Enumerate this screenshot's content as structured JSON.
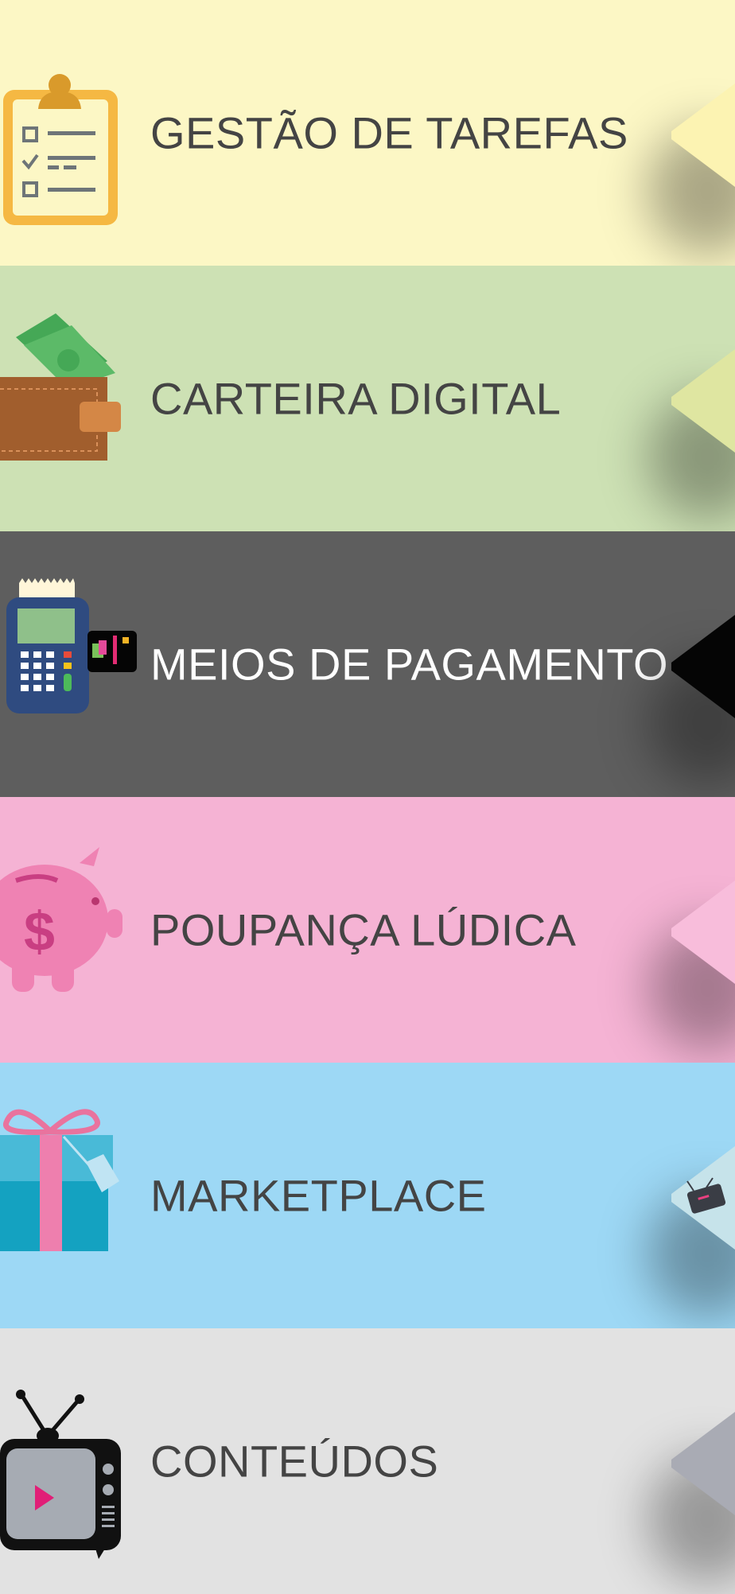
{
  "menu": {
    "items": [
      {
        "key": "tasks",
        "label": "GESTÃO DE TAREFAS",
        "bg": "#FCF7C5",
        "text_color": "#444444",
        "chevron_color": "#FCF3B2",
        "icon": "clipboard-checklist-icon"
      },
      {
        "key": "wallet",
        "label": "CARTEIRA DIGITAL",
        "bg": "#CDE1B4",
        "text_color": "#444444",
        "chevron_color": "#DFE6A1",
        "icon": "wallet-money-icon"
      },
      {
        "key": "payment",
        "label": "MEIOS DE PAGAMENTO",
        "bg": "#5E5E5E",
        "text_color": "#FFFFFF",
        "chevron_color": "#050505",
        "icon": "card-terminal-icon"
      },
      {
        "key": "savings",
        "label": "POUPANÇA LÚDICA",
        "bg": "#F5B3D4",
        "text_color": "#444444",
        "chevron_color": "#F8BDDB",
        "icon": "piggy-bank-icon"
      },
      {
        "key": "market",
        "label": "MARKETPLACE",
        "bg": "#9DD8F5",
        "text_color": "#444444",
        "chevron_color": "#C6E3EA",
        "icon": "gift-box-icon"
      },
      {
        "key": "content",
        "label": "CONTEÚDOS",
        "bg": "#E2E2E2",
        "text_color": "#444444",
        "chevron_color": "#A9ABB4",
        "icon": "tv-play-icon"
      }
    ]
  }
}
